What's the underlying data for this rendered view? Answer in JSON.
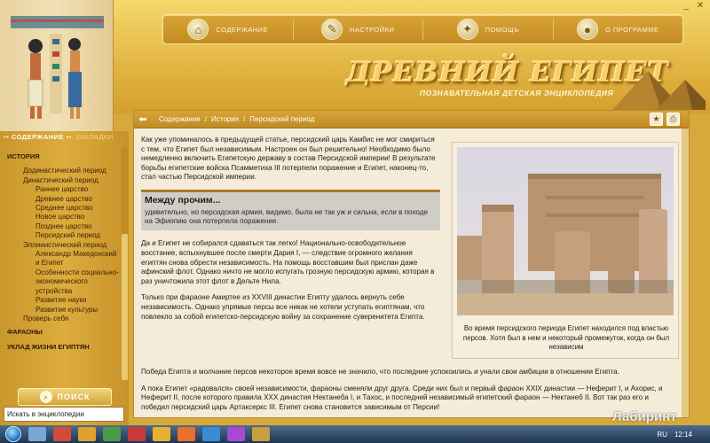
{
  "nav": {
    "items": [
      {
        "label": "СОДЕРЖАНИЕ",
        "icon": "home-icon"
      },
      {
        "label": "НАСТРОЙКИ",
        "icon": "wrench-icon"
      },
      {
        "label": "ПОМОЩЬ",
        "icon": "help-icon"
      },
      {
        "label": "О ПРОГРАММЕ",
        "icon": "info-icon"
      }
    ]
  },
  "logo": {
    "title": "ДРЕВНИЙ ЕГИПЕТ",
    "subtitle": "ПОЗНАВАТЕЛЬНАЯ ДЕТСКАЯ ЭНЦИКЛОПЕДИЯ"
  },
  "sidebar": {
    "tab_contents": "СОДЕРЖАНИЕ",
    "tab_bookmarks": "ЗАКЛАДКИ",
    "items": [
      {
        "label": "ИСТОРИЯ",
        "level": 0
      },
      {
        "label": "Додинастический период",
        "level": 1
      },
      {
        "label": "Династический период",
        "level": 1
      },
      {
        "label": "Раннее царство",
        "level": 2
      },
      {
        "label": "Древнее царство",
        "level": 2
      },
      {
        "label": "Среднее царство",
        "level": 2
      },
      {
        "label": "Новое царство",
        "level": 2
      },
      {
        "label": "Позднее царство",
        "level": 2
      },
      {
        "label": "Персидский период",
        "level": 2
      },
      {
        "label": "Эллинистический период",
        "level": 1
      },
      {
        "label": "Александр Македонский",
        "level": 2
      },
      {
        "label": "и Египет",
        "level": 2
      },
      {
        "label": "Особенности социально-",
        "level": 2
      },
      {
        "label": "экономического",
        "level": 2
      },
      {
        "label": "устройства",
        "level": 2
      },
      {
        "label": "Развитие науки",
        "level": 2
      },
      {
        "label": "Развитие культуры",
        "level": 2
      },
      {
        "label": "Проверь себя",
        "level": 1
      },
      {
        "label": "ФАРАОНЫ",
        "level": 0
      },
      {
        "label": "УКЛАД ЖИЗНИ ЕГИПТЯН",
        "level": 0
      }
    ],
    "search_label": "ПОИСК",
    "search_value": "Искать в энциклопедии"
  },
  "breadcrumb": {
    "parts": [
      "Содержание",
      "История",
      "Персидский период"
    ],
    "separator": "/"
  },
  "article": {
    "p1": "Как уже упоминалось в предыдущей статье, персидский царь Камбис не мог смириться с тем, что Египет был независимым. Настроен он был решительно! Необходимо было немедленно включить Египетскую державу в состав Персидской империи! В результате борьбы египетские войска Псамметиха III потерпели поражение и Египет, наконец-то, стал частью Персидской империи.",
    "note_title": "Между прочим...",
    "note_text": "удивительно, но персидская армия, видимо, была не так уж и сильна, если в походе на Эфиопию она потерпела поражение.",
    "p2": "Да и Египет не собирался сдаваться так легко! Национально-освободительное восстание, вспыхнувшее после смерти Дария I, — следствие огромного желания египтян снова обрести независимость. На помощь восставшим был прислан даже афинский флот. Однако ничто не могло испугать грозную персидскую армию, которая в раз уничтожила этот флот в Дельте Нила.",
    "p3": "Только при фараоне Амиртее из XXVIII династии Египту удалось вернуть себе независимость. Однако упрямые персы все никак не хотели уступать египтянам, что повлекло за собой египетско-персидскую войну за сохранение суверенитета Египта.",
    "p4": "Победа Египта и молчание персов некоторое время вовсе не значило, что последние успокоились и унали свои амбиции в отношении Египта.",
    "p5": "А пока Египет «радовался» своей независимости, фараоны сменяли друг друга. Среди них был и первый фараон XXIX династии — Неферит I, и Ахорис, и Неферит II, после которого правила XXX династия Нектанеба I, и Тахос, и последний независимый египетский фараон — Нектанеб II. Вот так раз его и победил персидский царь Артаксеркс III. Египет снова становится зависимым от Персии!",
    "caption": "Во время персидского периода Египет находился под властью персов. Хотя был в нем и некоторый промежуток, когда он был независим"
  },
  "taskbar": {
    "lang": "RU",
    "time": "12:14"
  },
  "watermark": "Лабиринт",
  "colors": {
    "gold": "#d7a93a",
    "panel_bg": "#f4ecd8",
    "note_bg": "#cfcdc5",
    "taskbar": "#1f3550"
  }
}
